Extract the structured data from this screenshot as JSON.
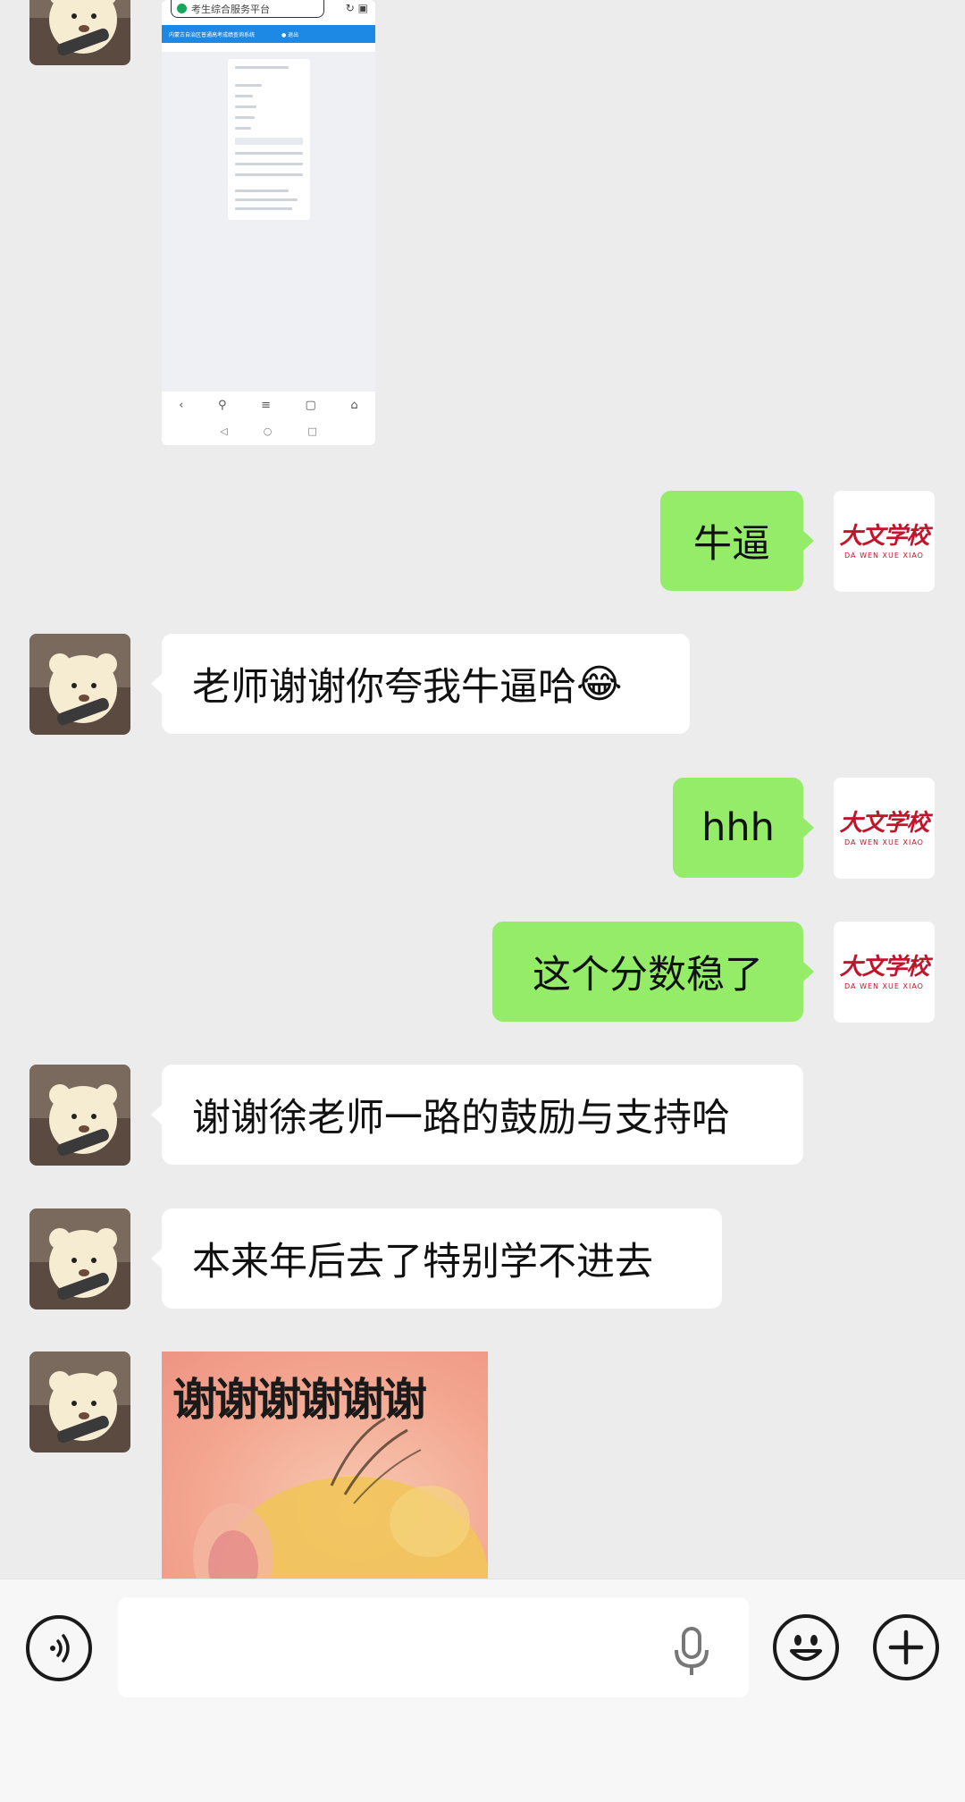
{
  "thumbnail": {
    "url_text": "考生综合服务平台",
    "banner_left": "内蒙古自治区普通高考成绩查询系统",
    "banner_right": "● 退出",
    "nav_icons": [
      "back-icon",
      "search-icon",
      "menu-icon",
      "tabs-icon",
      "home-icon"
    ],
    "system_nav_icons": [
      "back-triangle-icon",
      "home-circle-icon",
      "recent-square-icon"
    ]
  },
  "messages": [
    {
      "side": "out",
      "text": "牛逼"
    },
    {
      "side": "in",
      "text": "老师谢谢你夸我牛逼哈",
      "emoji": "😂"
    },
    {
      "side": "out",
      "text": "hhh"
    },
    {
      "side": "out",
      "text": "这个分数稳了"
    },
    {
      "side": "in",
      "text": "谢谢徐老师一路的鼓励与支持哈"
    },
    {
      "side": "in",
      "text": "本来年后去了特别学不进去"
    }
  ],
  "sticker": {
    "text": "谢谢谢谢谢谢"
  },
  "teacher_logo": {
    "cn": "大文学校",
    "en": "DA WEN XUE XIAO"
  },
  "input": {
    "placeholder": "",
    "value": ""
  },
  "colors": {
    "outgoing_bubble": "#95ec69",
    "incoming_bubble": "#ffffff",
    "background": "#ececec",
    "logo_red": "#c0152b"
  }
}
